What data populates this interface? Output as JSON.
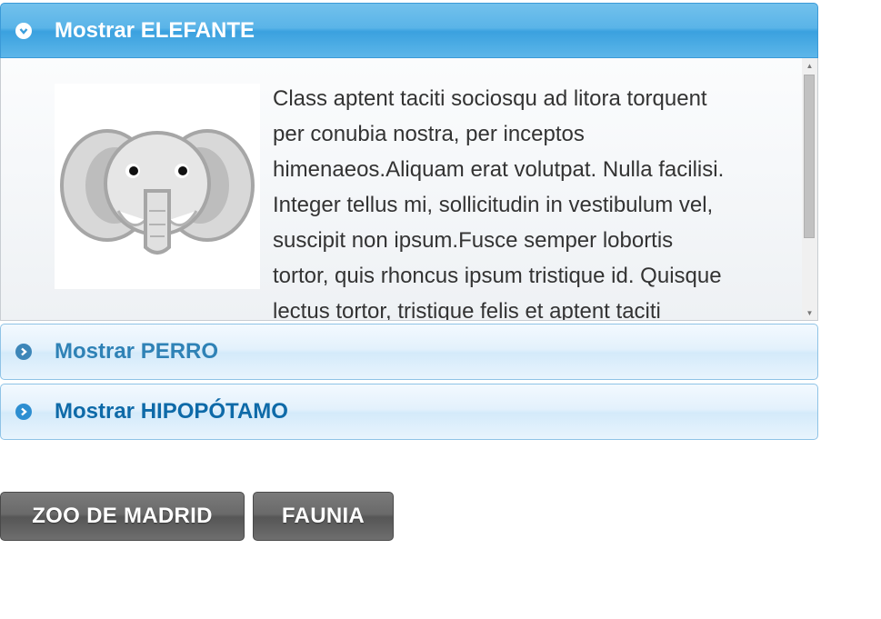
{
  "accordion": {
    "sections": [
      {
        "title": "Mostrar ELEFANTE",
        "expanded": true,
        "icon": "chevron-down-icon",
        "image": "elephant-icon",
        "text": "Class aptent taciti sociosqu ad litora torquent per conubia nostra, per inceptos himenaeos.Aliquam erat volutpat. Nulla facilisi. Integer tellus mi, sollicitudin in vestibulum vel, suscipit non ipsum.Fusce semper lobortis tortor, quis rhoncus ipsum tristique id. Quisque lectus tortor, tristique felis et aptent taciti"
      },
      {
        "title": "Mostrar PERRO",
        "expanded": false,
        "icon": "chevron-right-icon"
      },
      {
        "title": "Mostrar HIPOPÓTAMO",
        "expanded": false,
        "icon": "chevron-right-icon"
      }
    ]
  },
  "buttons": {
    "zoo_label": "ZOO DE MADRID",
    "faunia_label": "FAUNIA"
  },
  "colors": {
    "header_active": "#5ab4e8",
    "header_inactive": "#e3f1fc",
    "button_bg": "#6a6a6a"
  }
}
